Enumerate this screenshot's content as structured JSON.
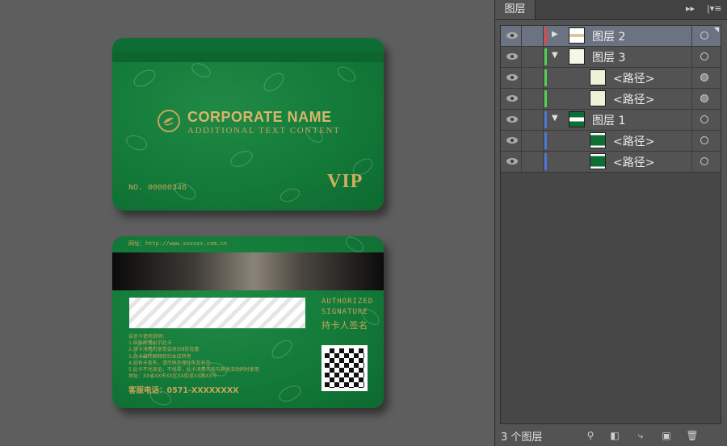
{
  "canvas": {
    "front_card": {
      "corporate_name": "CORPORATE NAME",
      "additional_text": "ADDITIONAL TEXT CONTENT",
      "card_number": "NO. 00000346",
      "vip_label": "VIP"
    },
    "back_card": {
      "website": "网址：http://www.xxxxxx.com.cn",
      "signature_label_1": "AUTHORIZED",
      "signature_label_2": "SIGNATURE",
      "signature_label_cn": "持卡人签名",
      "rules": [
        "会员卡使用说明：",
        "1.结账前请出示此卡",
        "2.持卡消费可享受会员价8折优惠",
        "3.此卡最终解释权归本店所有",
        "4.如有卡丢失，请尽快办理挂失及补办",
        "5.此卡不兑现金，不找零，此卡消费不能与其他活动同时享用",
        "地址：XX省XX市XX区XX街道XX路XX号"
      ],
      "hotline": "客服电话：0571-XXXXXXXX"
    }
  },
  "layers_panel": {
    "tab_label": "图层",
    "collapse_icon": "double-chevron-right-icon",
    "menu_icon": "panel-menu-icon",
    "layers": [
      {
        "name": "图层 2",
        "level": 0,
        "expanded": false,
        "color": "#e04848",
        "selected": true,
        "target_filled": false
      },
      {
        "name": "图层 3",
        "level": 0,
        "expanded": true,
        "color": "#4fd34f",
        "selected": false,
        "target_filled": false
      },
      {
        "name": "<路径>",
        "level": 1,
        "expanded": null,
        "color": "#4fd34f",
        "selected": false,
        "target_filled": true
      },
      {
        "name": "<路径>",
        "level": 1,
        "expanded": null,
        "color": "#4fd34f",
        "selected": false,
        "target_filled": true
      },
      {
        "name": "图层 1",
        "level": 0,
        "expanded": true,
        "color": "#4a78d8",
        "selected": false,
        "target_filled": false
      },
      {
        "name": "<路径>",
        "level": 1,
        "expanded": null,
        "color": "#4a78d8",
        "selected": false,
        "target_filled": false
      },
      {
        "name": "<路径>",
        "level": 1,
        "expanded": null,
        "color": "#4a78d8",
        "selected": false,
        "target_filled": false
      }
    ],
    "footer": {
      "layer_count": "3 个图层",
      "icons": [
        "locate-object-icon",
        "make-clipping-mask-icon",
        "new-sublayer-icon",
        "new-layer-icon",
        "delete-icon"
      ]
    }
  }
}
